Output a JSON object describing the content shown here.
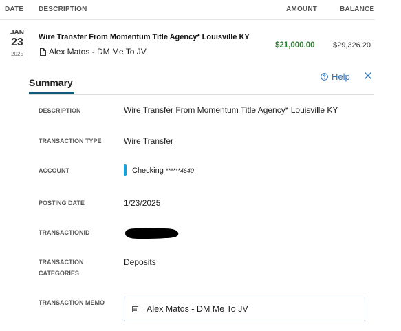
{
  "table_header": {
    "date": "DATE",
    "description": "DESCRIPTION",
    "amount": "AMOUNT",
    "balance": "BALANCE"
  },
  "transaction": {
    "month": "JAN",
    "day": "23",
    "year": "2025",
    "title": "Wire Transfer From Momentum Title Agency* Louisville KY",
    "memo_preview": "Alex Matos - DM Me To JV",
    "amount": "$21,000.00",
    "balance": "$29,326.20"
  },
  "panel": {
    "tab_label": "Summary",
    "help_label": "Help",
    "accent_color": "#0e5a77",
    "link_color": "#2b74b8",
    "amount_color": "#2e7d32"
  },
  "details": {
    "description_label": "DESCRIPTION",
    "description_value": "Wire Transfer From Momentum Title Agency* Louisville KY",
    "type_label": "TRANSACTION TYPE",
    "type_value": "Wire Transfer",
    "account_label": "ACCOUNT",
    "account_name": "Checking",
    "account_mask": "******4640",
    "account_color": "#1a9fd6",
    "posting_label": "POSTING DATE",
    "posting_value": "1/23/2025",
    "txid_label": "TRANSACTIONID",
    "categories_label_1": "TRANSACTION",
    "categories_label_2": "CATEGORIES",
    "categories_value": "Deposits",
    "memo_label": "TRANSACTION MEMO",
    "memo_value": "Alex Matos - DM Me To JV"
  }
}
